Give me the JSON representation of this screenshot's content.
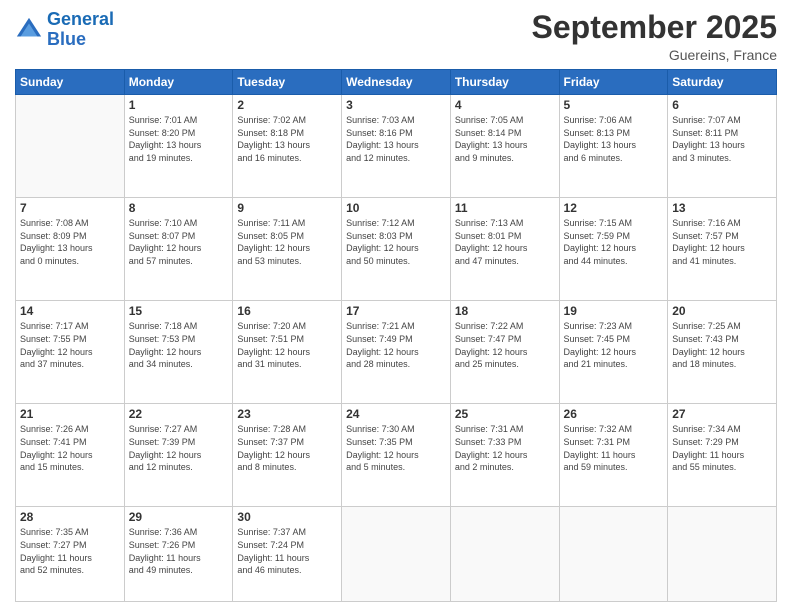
{
  "header": {
    "logo_line1": "General",
    "logo_line2": "Blue",
    "title": "September 2025",
    "subtitle": "Guereins, France"
  },
  "days_of_week": [
    "Sunday",
    "Monday",
    "Tuesday",
    "Wednesday",
    "Thursday",
    "Friday",
    "Saturday"
  ],
  "weeks": [
    [
      {
        "day": "",
        "info": ""
      },
      {
        "day": "1",
        "info": "Sunrise: 7:01 AM\nSunset: 8:20 PM\nDaylight: 13 hours\nand 19 minutes."
      },
      {
        "day": "2",
        "info": "Sunrise: 7:02 AM\nSunset: 8:18 PM\nDaylight: 13 hours\nand 16 minutes."
      },
      {
        "day": "3",
        "info": "Sunrise: 7:03 AM\nSunset: 8:16 PM\nDaylight: 13 hours\nand 12 minutes."
      },
      {
        "day": "4",
        "info": "Sunrise: 7:05 AM\nSunset: 8:14 PM\nDaylight: 13 hours\nand 9 minutes."
      },
      {
        "day": "5",
        "info": "Sunrise: 7:06 AM\nSunset: 8:13 PM\nDaylight: 13 hours\nand 6 minutes."
      },
      {
        "day": "6",
        "info": "Sunrise: 7:07 AM\nSunset: 8:11 PM\nDaylight: 13 hours\nand 3 minutes."
      }
    ],
    [
      {
        "day": "7",
        "info": "Sunrise: 7:08 AM\nSunset: 8:09 PM\nDaylight: 13 hours\nand 0 minutes."
      },
      {
        "day": "8",
        "info": "Sunrise: 7:10 AM\nSunset: 8:07 PM\nDaylight: 12 hours\nand 57 minutes."
      },
      {
        "day": "9",
        "info": "Sunrise: 7:11 AM\nSunset: 8:05 PM\nDaylight: 12 hours\nand 53 minutes."
      },
      {
        "day": "10",
        "info": "Sunrise: 7:12 AM\nSunset: 8:03 PM\nDaylight: 12 hours\nand 50 minutes."
      },
      {
        "day": "11",
        "info": "Sunrise: 7:13 AM\nSunset: 8:01 PM\nDaylight: 12 hours\nand 47 minutes."
      },
      {
        "day": "12",
        "info": "Sunrise: 7:15 AM\nSunset: 7:59 PM\nDaylight: 12 hours\nand 44 minutes."
      },
      {
        "day": "13",
        "info": "Sunrise: 7:16 AM\nSunset: 7:57 PM\nDaylight: 12 hours\nand 41 minutes."
      }
    ],
    [
      {
        "day": "14",
        "info": "Sunrise: 7:17 AM\nSunset: 7:55 PM\nDaylight: 12 hours\nand 37 minutes."
      },
      {
        "day": "15",
        "info": "Sunrise: 7:18 AM\nSunset: 7:53 PM\nDaylight: 12 hours\nand 34 minutes."
      },
      {
        "day": "16",
        "info": "Sunrise: 7:20 AM\nSunset: 7:51 PM\nDaylight: 12 hours\nand 31 minutes."
      },
      {
        "day": "17",
        "info": "Sunrise: 7:21 AM\nSunset: 7:49 PM\nDaylight: 12 hours\nand 28 minutes."
      },
      {
        "day": "18",
        "info": "Sunrise: 7:22 AM\nSunset: 7:47 PM\nDaylight: 12 hours\nand 25 minutes."
      },
      {
        "day": "19",
        "info": "Sunrise: 7:23 AM\nSunset: 7:45 PM\nDaylight: 12 hours\nand 21 minutes."
      },
      {
        "day": "20",
        "info": "Sunrise: 7:25 AM\nSunset: 7:43 PM\nDaylight: 12 hours\nand 18 minutes."
      }
    ],
    [
      {
        "day": "21",
        "info": "Sunrise: 7:26 AM\nSunset: 7:41 PM\nDaylight: 12 hours\nand 15 minutes."
      },
      {
        "day": "22",
        "info": "Sunrise: 7:27 AM\nSunset: 7:39 PM\nDaylight: 12 hours\nand 12 minutes."
      },
      {
        "day": "23",
        "info": "Sunrise: 7:28 AM\nSunset: 7:37 PM\nDaylight: 12 hours\nand 8 minutes."
      },
      {
        "day": "24",
        "info": "Sunrise: 7:30 AM\nSunset: 7:35 PM\nDaylight: 12 hours\nand 5 minutes."
      },
      {
        "day": "25",
        "info": "Sunrise: 7:31 AM\nSunset: 7:33 PM\nDaylight: 12 hours\nand 2 minutes."
      },
      {
        "day": "26",
        "info": "Sunrise: 7:32 AM\nSunset: 7:31 PM\nDaylight: 11 hours\nand 59 minutes."
      },
      {
        "day": "27",
        "info": "Sunrise: 7:34 AM\nSunset: 7:29 PM\nDaylight: 11 hours\nand 55 minutes."
      }
    ],
    [
      {
        "day": "28",
        "info": "Sunrise: 7:35 AM\nSunset: 7:27 PM\nDaylight: 11 hours\nand 52 minutes."
      },
      {
        "day": "29",
        "info": "Sunrise: 7:36 AM\nSunset: 7:26 PM\nDaylight: 11 hours\nand 49 minutes."
      },
      {
        "day": "30",
        "info": "Sunrise: 7:37 AM\nSunset: 7:24 PM\nDaylight: 11 hours\nand 46 minutes."
      },
      {
        "day": "",
        "info": ""
      },
      {
        "day": "",
        "info": ""
      },
      {
        "day": "",
        "info": ""
      },
      {
        "day": "",
        "info": ""
      }
    ]
  ]
}
